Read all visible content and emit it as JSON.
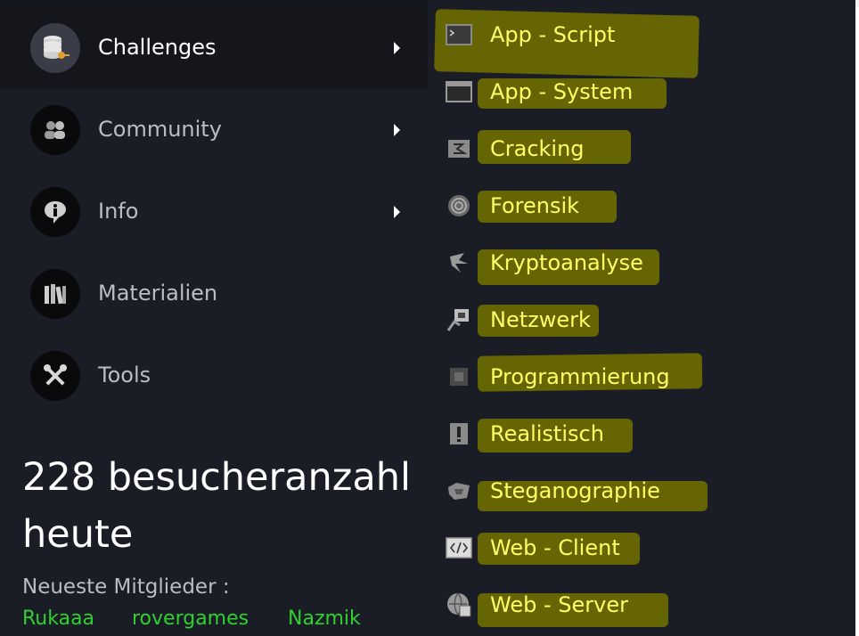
{
  "sidebar": {
    "items": [
      {
        "label": "Challenges",
        "icon": "database-key-icon",
        "active": true,
        "has_submenu": true
      },
      {
        "label": "Community",
        "icon": "users-icon",
        "active": false,
        "has_submenu": true
      },
      {
        "label": "Info",
        "icon": "info-bubble-icon",
        "active": false,
        "has_submenu": true
      },
      {
        "label": "Materialien",
        "icon": "books-icon",
        "active": false,
        "has_submenu": false
      },
      {
        "label": "Tools",
        "icon": "tools-icon",
        "active": false,
        "has_submenu": false
      }
    ]
  },
  "stats": {
    "visitors_line1": "228 besucheranzahl",
    "visitors_line2": "heute",
    "members_label": "Neueste Mitglieder :",
    "members": [
      "Rukaaa",
      "rovergames",
      "Nazmik"
    ]
  },
  "submenu": {
    "items": [
      {
        "label": "App - Script",
        "icon": "terminal-icon"
      },
      {
        "label": "App - System",
        "icon": "window-icon"
      },
      {
        "label": "Cracking",
        "icon": "cracking-icon"
      },
      {
        "label": "Forensik",
        "icon": "fingerprint-icon"
      },
      {
        "label": "Kryptoanalyse",
        "icon": "crypto-icon"
      },
      {
        "label": "Netzwerk",
        "icon": "network-icon"
      },
      {
        "label": "Programmierung",
        "icon": "chip-icon"
      },
      {
        "label": "Realistisch",
        "icon": "realistic-icon"
      },
      {
        "label": "Steganographie",
        "icon": "stego-icon"
      },
      {
        "label": "Web - Client",
        "icon": "code-tag-icon"
      },
      {
        "label": "Web - Server",
        "icon": "server-icon"
      }
    ]
  },
  "colors": {
    "background": "#1b1d26",
    "highlight": "#6b6b00",
    "submenu_text": "#ffff66",
    "member_link": "#2ed12e"
  }
}
